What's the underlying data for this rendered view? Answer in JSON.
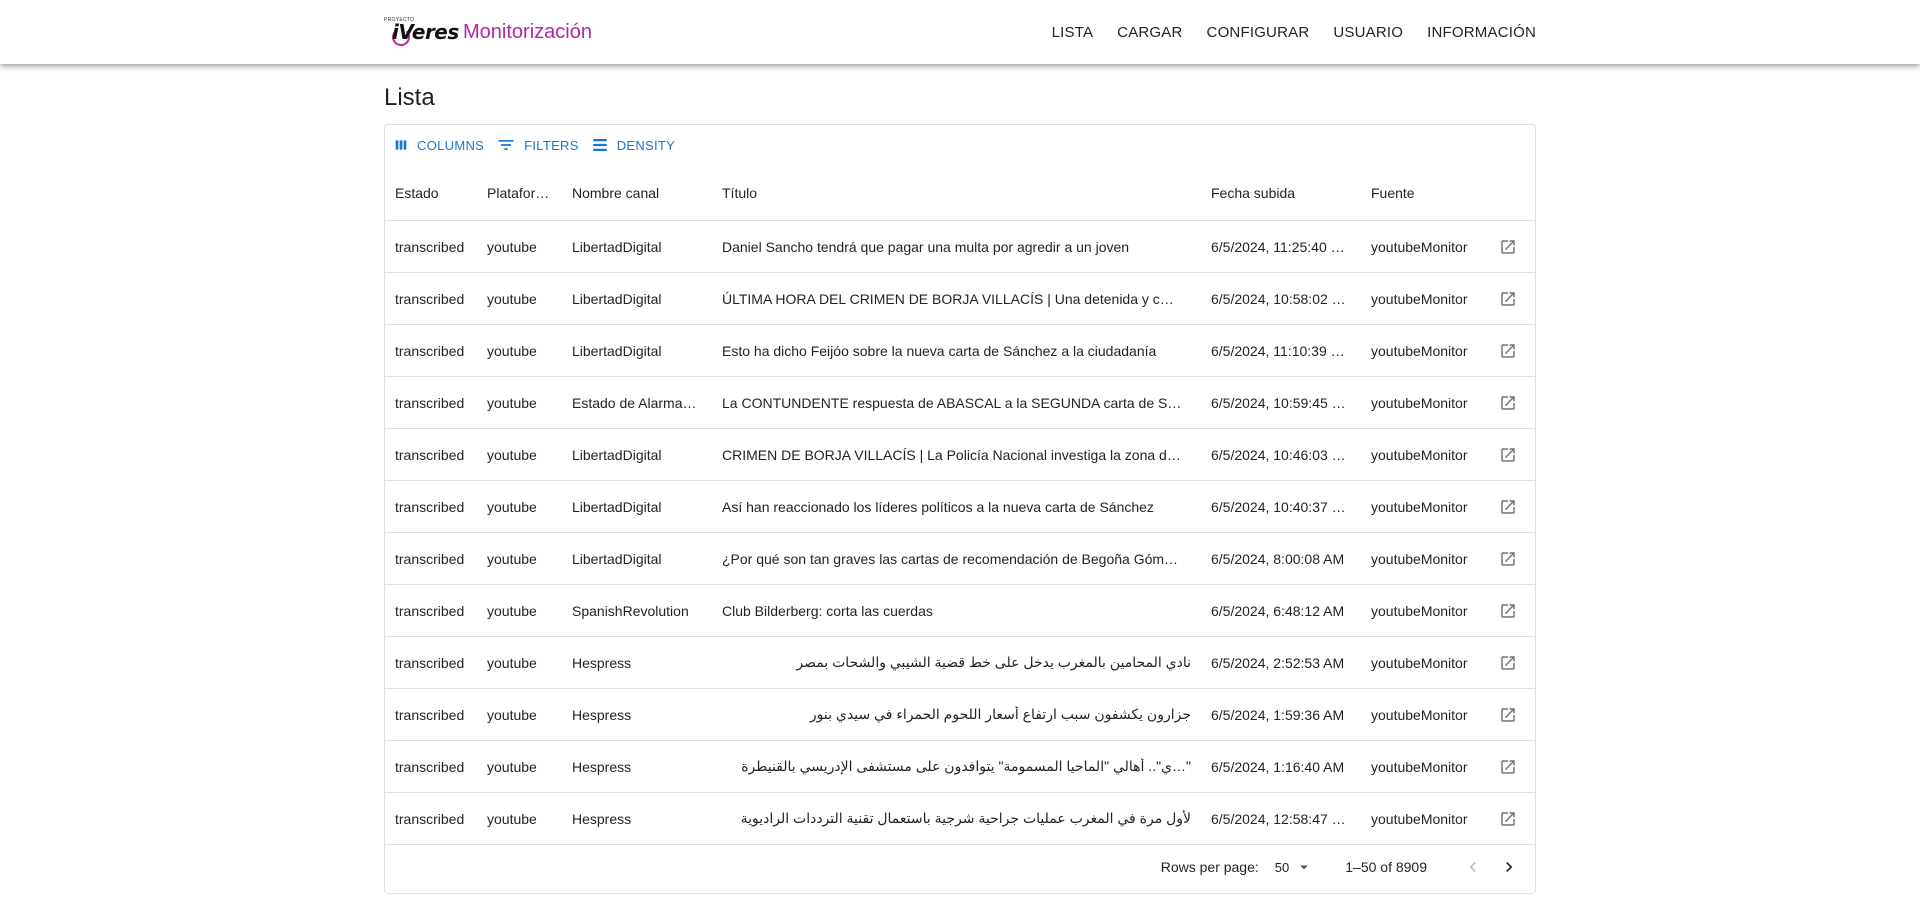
{
  "app": {
    "logo_small_text": "PROYECTO",
    "logo_text": "iVeres",
    "title": "Monitorización",
    "brand_color": "#b426a8"
  },
  "nav": [
    {
      "label": "LISTA"
    },
    {
      "label": "CARGAR"
    },
    {
      "label": "CONFIGURAR"
    },
    {
      "label": "USUARIO"
    },
    {
      "label": "INFORMACIÓN"
    }
  ],
  "page": {
    "title": "Lista"
  },
  "toolbar": {
    "columns_label": "Columns",
    "filters_label": "Filters",
    "density_label": "Density",
    "accent_color": "#1976d2"
  },
  "table": {
    "headers": {
      "estado": "Estado",
      "plataforma": "Plataforma",
      "canal": "Nombre canal",
      "titulo": "Título",
      "fecha": "Fecha subida",
      "fuente": "Fuente"
    },
    "rows": [
      {
        "estado": "transcribed",
        "plataforma": "youtube",
        "canal": "LibertadDigital",
        "titulo": "Daniel Sancho tendrá que pagar una multa por agredir a un joven",
        "fecha": "6/5/2024, 11:25:40 …",
        "fuente": "youtubeMonitor"
      },
      {
        "estado": "transcribed",
        "plataforma": "youtube",
        "canal": "LibertadDigital",
        "titulo": "ÚLTIMA HORA DEL CRIMEN DE BORJA VILLACÍS | Una detenida y c…",
        "fecha": "6/5/2024, 10:58:02 …",
        "fuente": "youtubeMonitor"
      },
      {
        "estado": "transcribed",
        "plataforma": "youtube",
        "canal": "LibertadDigital",
        "titulo": "Esto ha dicho Feijóo sobre la nueva carta de Sánchez a la ciudadanía",
        "fecha": "6/5/2024, 11:10:39 …",
        "fuente": "youtubeMonitor"
      },
      {
        "estado": "transcribed",
        "plataforma": "youtube",
        "canal": "Estado de Alarma…",
        "titulo": "La CONTUNDENTE respuesta de ABASCAL a la SEGUNDA carta de S…",
        "fecha": "6/5/2024, 10:59:45 …",
        "fuente": "youtubeMonitor"
      },
      {
        "estado": "transcribed",
        "plataforma": "youtube",
        "canal": "LibertadDigital",
        "titulo": "CRIMEN DE BORJA VILLACÍS | La Policía Nacional investiga la zona d…",
        "fecha": "6/5/2024, 10:46:03 …",
        "fuente": "youtubeMonitor"
      },
      {
        "estado": "transcribed",
        "plataforma": "youtube",
        "canal": "LibertadDigital",
        "titulo": "Así han reaccionado los líderes políticos a la nueva carta de Sánchez",
        "fecha": "6/5/2024, 10:40:37 …",
        "fuente": "youtubeMonitor"
      },
      {
        "estado": "transcribed",
        "plataforma": "youtube",
        "canal": "LibertadDigital",
        "titulo": "¿Por qué son tan graves las cartas de recomendación de Begoña Góm…",
        "fecha": "6/5/2024, 8:00:08 AM",
        "fuente": "youtubeMonitor"
      },
      {
        "estado": "transcribed",
        "plataforma": "youtube",
        "canal": "SpanishRevolution",
        "titulo": "Club Bilderberg: corta las cuerdas",
        "fecha": "6/5/2024, 6:48:12 AM",
        "fuente": "youtubeMonitor"
      },
      {
        "estado": "transcribed",
        "plataforma": "youtube",
        "canal": "Hespress",
        "titulo": "نادي المحامين بالمغرب يدخل على خط قضية الشيبي والشحات بمصر",
        "fecha": "6/5/2024, 2:52:53 AM",
        "fuente": "youtubeMonitor"
      },
      {
        "estado": "transcribed",
        "plataforma": "youtube",
        "canal": "Hespress",
        "titulo": "جزارون يكشفون سبب ارتفاع أسعار اللحوم الحمراء في سيدي بنور",
        "fecha": "6/5/2024, 1:59:36 AM",
        "fuente": "youtubeMonitor"
      },
      {
        "estado": "transcribed",
        "plataforma": "youtube",
        "canal": "Hespress",
        "titulo": "\"…ي\".. أهالي \"الماحيا المسمومة\" يتوافدون على مستشفى الإدريسي بالقنيطرة",
        "fecha": "6/5/2024, 1:16:40 AM",
        "fuente": "youtubeMonitor"
      },
      {
        "estado": "transcribed",
        "plataforma": "youtube",
        "canal": "Hespress",
        "titulo": "لأول مرة في المغرب عمليات جراحية شرجية باستعمال تقنية الترددات الراديوية",
        "fecha": "6/5/2024, 12:58:47 …",
        "fuente": "youtubeMonitor"
      }
    ]
  },
  "footer": {
    "rows_per_page_label": "Rows per page:",
    "rows_per_page_value": "50",
    "range_label": "1–50 of 8909"
  }
}
